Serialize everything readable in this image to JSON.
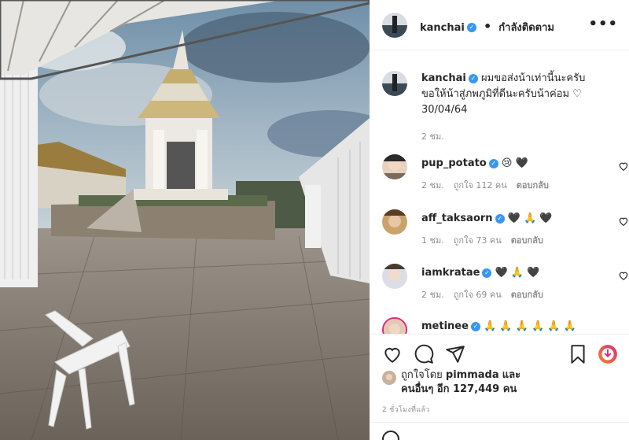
{
  "post": {
    "username": "kanchai",
    "separator": "•",
    "follow_status": "กำลังติดตาม",
    "more_label": "•••",
    "caption_lines": [
      "ผมขอส่งน้าเท่านี้นะครับ",
      "ขอให้น้าสู่ภพภูมิที่ดีนะครับน้าค่อม ♡",
      "30/04/64"
    ],
    "caption_time": "2 ชม."
  },
  "comments": [
    {
      "username": "pup_potato",
      "emojis": "😢 🖤",
      "time": "2 ชม.",
      "likes": "ถูกใจ 112 คน",
      "reply": "ตอบกลับ"
    },
    {
      "username": "aff_taksaorn",
      "emojis": "🖤 🙏 🖤",
      "time": "1 ชม.",
      "likes": "ถูกใจ 73 คน",
      "reply": "ตอบกลับ"
    },
    {
      "username": "iamkratae",
      "emojis": "🖤 🙏 🖤",
      "time": "2 ชม.",
      "likes": "ถูกใจ 69 คน",
      "reply": "ตอบกลับ"
    },
    {
      "username": "metinee",
      "emojis": "🙏 🙏 🙏 🙏 🙏 🙏"
    }
  ],
  "liked_by": {
    "prefix": "ถูกใจโดย",
    "user": "pimmada",
    "and": "และ",
    "others": "คนอื่นๆ อีก 127,449 คน"
  },
  "posted_ago": "2 ชั่วโมงที่แล้ว",
  "icons": [
    "heart-icon",
    "comment-icon",
    "share-icon",
    "bookmark-icon",
    "download-badge-icon",
    "verified-badge-icon",
    "more-icon",
    "emoji-icon"
  ],
  "colors": {
    "verified": "#3897f0",
    "meta_gray": "#8e8e8e",
    "border": "#efefef",
    "badge_gradient_start": "#f58529",
    "badge_gradient_end": "#dd2a7b"
  }
}
